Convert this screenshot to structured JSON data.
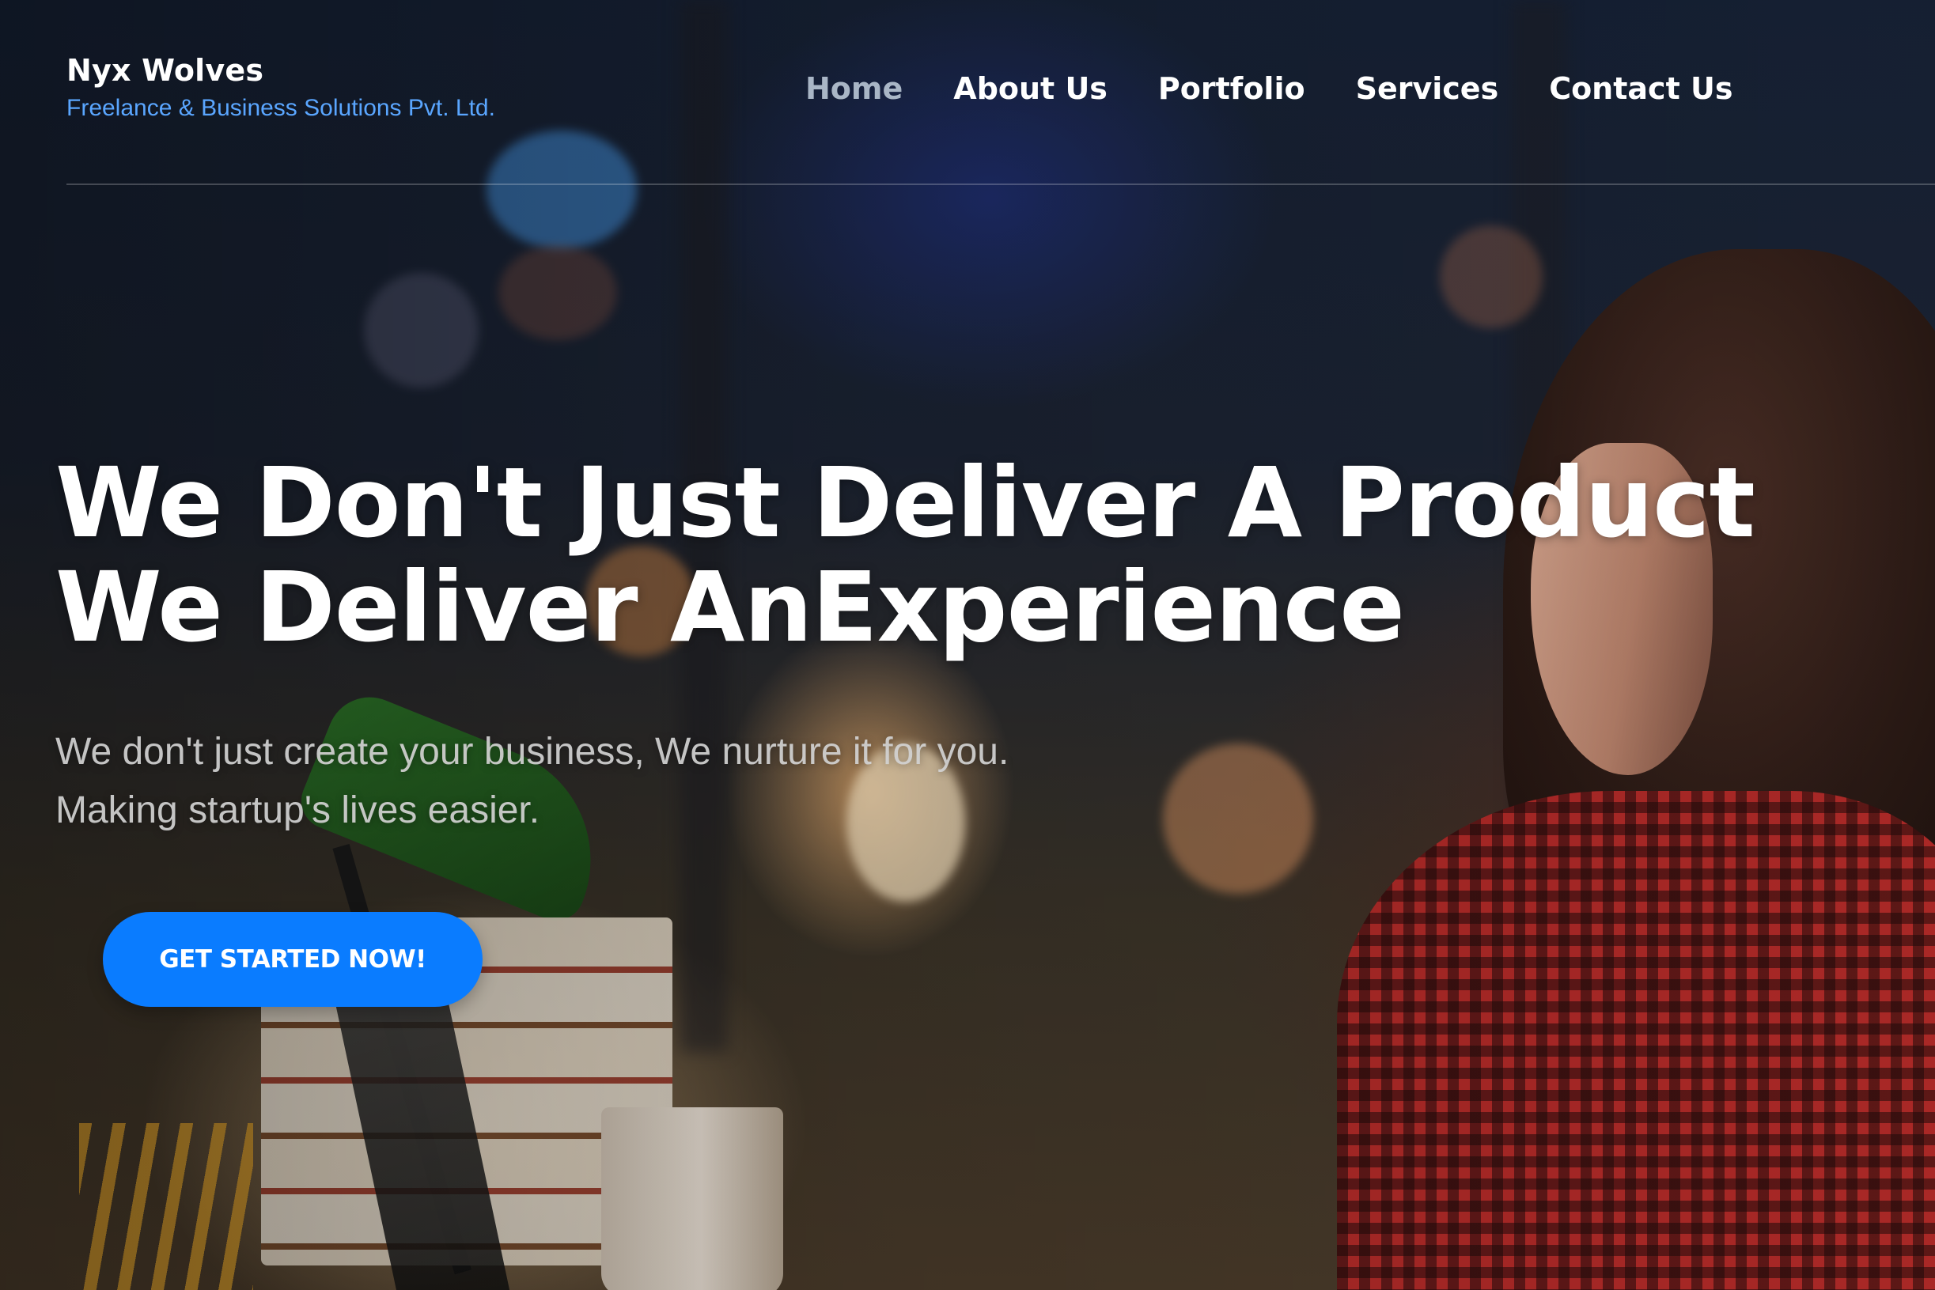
{
  "brand": {
    "name": "Nyx Wolves",
    "tagline": "Freelance & Business Solutions Pvt. Ltd."
  },
  "nav": {
    "items": [
      {
        "label": "Home",
        "active": true
      },
      {
        "label": "About Us",
        "active": false
      },
      {
        "label": "Portfolio",
        "active": false
      },
      {
        "label": "Services",
        "active": false
      },
      {
        "label": "Contact Us",
        "active": false
      }
    ]
  },
  "hero": {
    "headline_line1": "We Don't Just Deliver A Product",
    "headline_line2": "We Deliver AnExperience",
    "subtext_line1": "We don't just create your business, We nurture it for you.",
    "subtext_line2": "Making startup's lives easier.",
    "cta_label": "GET STARTED NOW!"
  },
  "colors": {
    "accent_blue": "#0a7cff",
    "tagline_blue": "#5aa6ff",
    "nav_active": "#a9b6c6",
    "text_white": "#ffffff"
  }
}
